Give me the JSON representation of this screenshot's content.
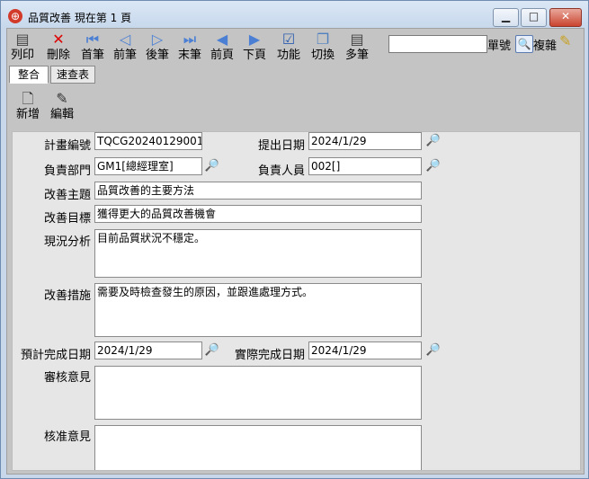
{
  "window": {
    "title": "品質改善 現在第 1 頁",
    "app_icon": "globe-icon"
  },
  "toolbar": {
    "buttons": [
      {
        "label": "列印",
        "icon": "printer-icon"
      },
      {
        "label": "刪除",
        "icon": "delete-icon"
      },
      {
        "label": "首筆",
        "icon": "first-record-icon"
      },
      {
        "label": "前筆",
        "icon": "previous-record-icon"
      },
      {
        "label": "後筆",
        "icon": "next-record-icon"
      },
      {
        "label": "末筆",
        "icon": "last-record-icon"
      },
      {
        "label": "前頁",
        "icon": "previous-page-icon"
      },
      {
        "label": "下頁",
        "icon": "next-page-icon"
      },
      {
        "label": "功能",
        "icon": "function-icon"
      },
      {
        "label": "切換",
        "icon": "switch-icon"
      },
      {
        "label": "多筆",
        "icon": "multi-record-icon"
      }
    ],
    "search_value": "",
    "single_label": "單號",
    "complex_label": "複雜"
  },
  "tabs": [
    {
      "label": "整合"
    },
    {
      "label": "速查表"
    }
  ],
  "subtoolbar": {
    "new_label": "新增",
    "edit_label": "編輯"
  },
  "form": {
    "plan_no_label": "計畫編號",
    "plan_no_value": "TQCG20240129001",
    "submit_date_label": "提出日期",
    "submit_date_value": "2024/1/29",
    "dept_label": "負責部門",
    "dept_value": "GM1[總經理室]",
    "person_label": "負責人員",
    "person_value": "002[]",
    "topic_label": "改善主題",
    "topic_value": "品質改善的主要方法",
    "goal_label": "改善目標",
    "goal_value": "獲得更大的品質改善機會",
    "status_label": "現況分析",
    "status_value": "目前品質狀況不穩定。",
    "measure_label": "改善措施",
    "measure_value": "需要及時檢查發生的原因，並跟進處理方式。",
    "planned_date_label": "預計完成日期",
    "planned_date_value": "2024/1/29",
    "actual_date_label": "實際完成日期",
    "actual_date_value": "2024/1/29",
    "review_label": "審核意見",
    "review_value": "",
    "approve_label": "核准意見",
    "approve_value": ""
  }
}
